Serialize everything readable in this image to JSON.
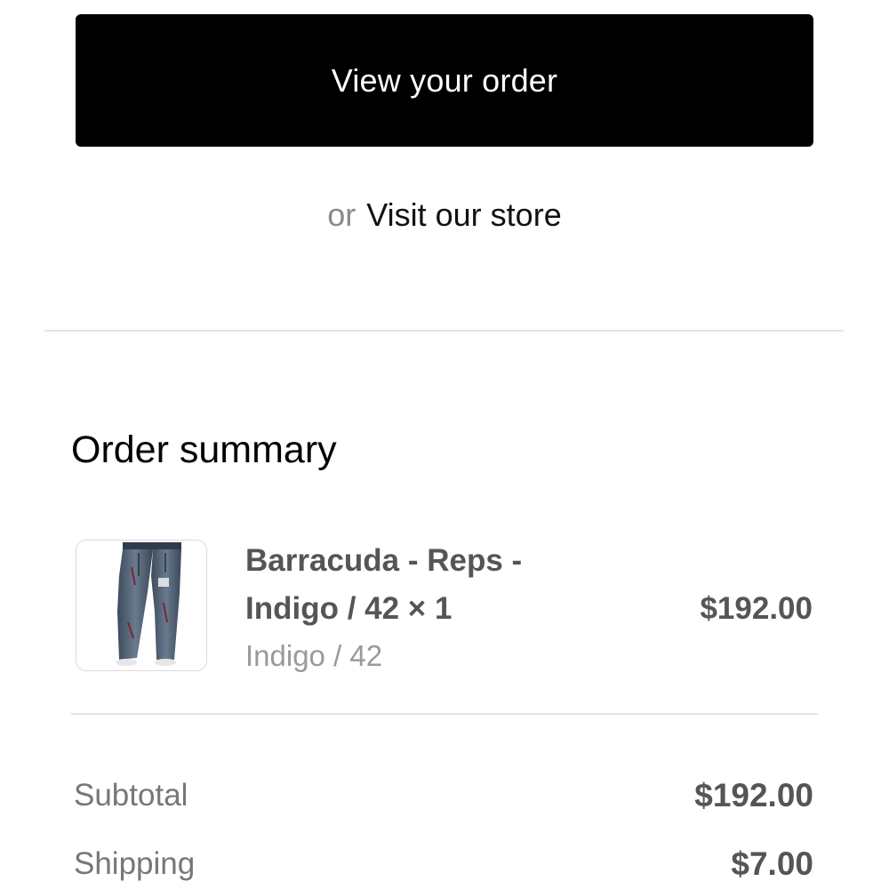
{
  "actions": {
    "view_order_label": "View your order",
    "or_text": "or",
    "visit_store_label": "Visit our store"
  },
  "summary": {
    "title": "Order summary",
    "items": [
      {
        "name": "Barracuda - Reps - Indigo / 42 × 1",
        "variant": "Indigo / 42",
        "price": "$192.00",
        "image_icon": "jeans-icon"
      }
    ],
    "totals": {
      "subtotal_label": "Subtotal",
      "subtotal_value": "$192.00",
      "shipping_label": "Shipping",
      "shipping_value": "$7.00"
    }
  },
  "colors": {
    "primary_button_bg": "#000000",
    "primary_button_text": "#ffffff",
    "divider": "#e3e3e3",
    "muted_text": "#8a8a8a"
  }
}
